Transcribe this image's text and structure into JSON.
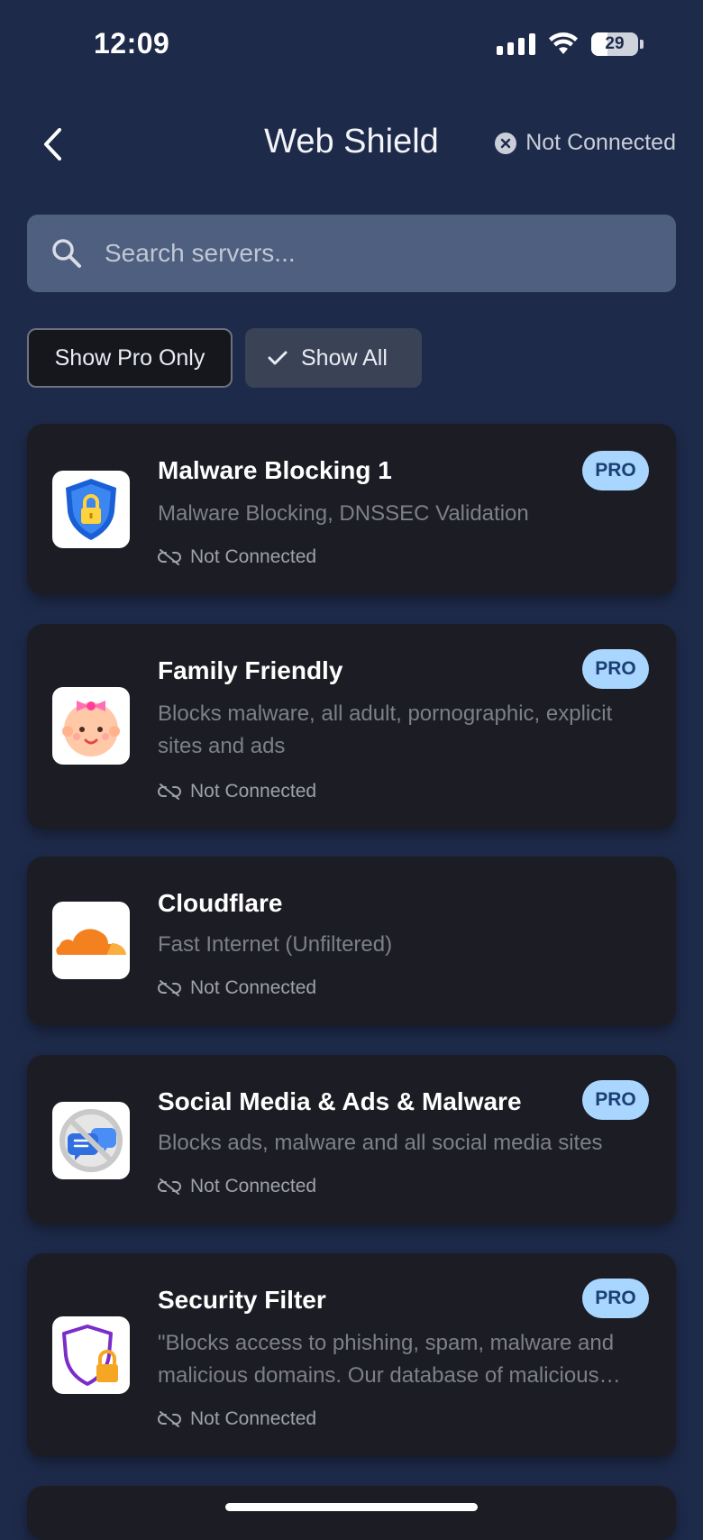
{
  "status": {
    "time": "12:09",
    "battery": "29"
  },
  "header": {
    "title": "Web Shield",
    "connection_status": "Not Connected"
  },
  "search": {
    "placeholder": "Search servers..."
  },
  "filters": {
    "pro_only": "Show Pro Only",
    "show_all": "Show All"
  },
  "servers": [
    {
      "name": "Malware Blocking 1",
      "description": "Malware Blocking, DNSSEC Validation",
      "status": "Not Connected",
      "badge": "PRO",
      "icon": "shield-lock-icon"
    },
    {
      "name": "Family Friendly",
      "description": "Blocks malware, all adult, pornographic, explicit sites and ads",
      "status": "Not Connected",
      "badge": "PRO",
      "icon": "baby-face-icon"
    },
    {
      "name": "Cloudflare",
      "description": "Fast Internet (Unfiltered)",
      "status": "Not Connected",
      "badge": "",
      "icon": "cloudflare-icon"
    },
    {
      "name": "Social Media & Ads & Malware",
      "description": "Blocks ads, malware and all social media sites",
      "status": "Not Connected",
      "badge": "PRO",
      "icon": "no-chat-icon"
    },
    {
      "name": "Security Filter",
      "description": "\"Blocks access to phishing, spam, malware and malicious domains. Our database of malicious domains is updated daily\"",
      "status": "Not Connected",
      "badge": "PRO",
      "icon": "shield-padlock-icon"
    }
  ],
  "colors": {
    "background": "#1e2a4a",
    "card": "#1c1d24",
    "pro_badge": "#a9d6ff",
    "search_bar": "#4f5f7f"
  }
}
